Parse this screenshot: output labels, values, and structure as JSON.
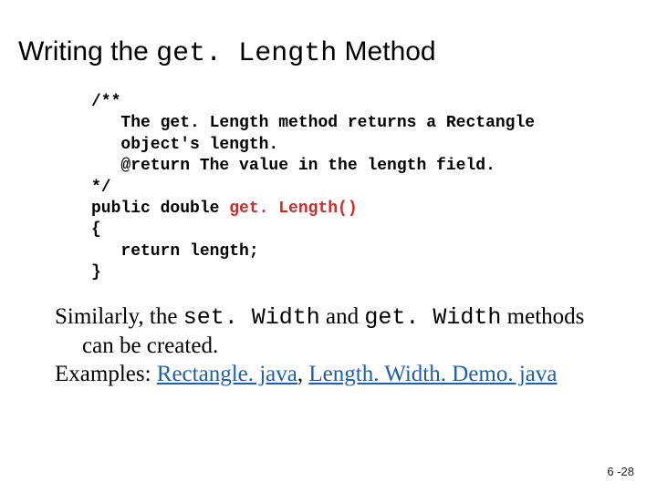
{
  "title": {
    "pre": "Writing the ",
    "mono": "get. Length",
    "post": " Method"
  },
  "code": {
    "l1": "/**",
    "l2": "   The get. Length method returns a Rectangle",
    "l3": "   object's length.",
    "l4": "   @return The value in the length field.",
    "l5": "*/",
    "l6a": "public double ",
    "l6b": "get. Length()",
    "l7": "{",
    "l8": "   return length;",
    "l9": "}"
  },
  "body": {
    "p1a": "Similarly, the ",
    "p1b": "set. Width",
    "p1c": " and ",
    "p1d": "get. Width",
    "p1e": " methods",
    "p2": "can be created.",
    "p3a": "Examples:  ",
    "link1": "Rectangle. java",
    "sep": ", ",
    "link2": "Length. Width. Demo. java"
  },
  "page": "6 -28"
}
